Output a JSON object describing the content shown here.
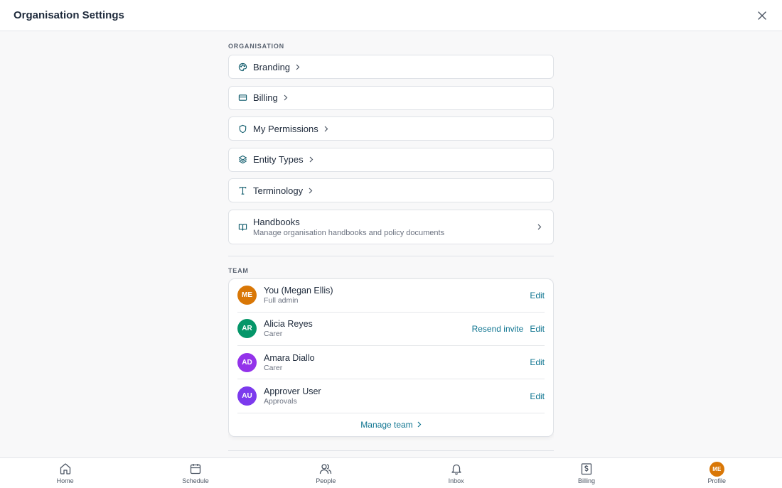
{
  "header": {
    "title": "Organisation Settings"
  },
  "org": {
    "section_label": "ORGANISATION",
    "items": [
      {
        "label": "Branding",
        "icon": "palette-icon"
      },
      {
        "label": "Billing",
        "icon": "credit-card-icon"
      },
      {
        "label": "My Permissions",
        "icon": "shield-icon"
      },
      {
        "label": "Entity Types",
        "icon": "layers-icon"
      },
      {
        "label": "Terminology",
        "icon": "type-icon"
      }
    ],
    "handbooks": {
      "label": "Handbooks",
      "subtitle": "Manage organisation handbooks and policy documents",
      "icon": "book-open-icon"
    }
  },
  "team": {
    "section_label": "TEAM",
    "members": [
      {
        "initials": "ME",
        "name": "You (Megan Ellis)",
        "role": "Full admin",
        "color": "#d97706",
        "actions": [
          "Edit"
        ]
      },
      {
        "initials": "AR",
        "name": "Alicia Reyes",
        "role": "Carer",
        "color": "#059669",
        "actions": [
          "Resend invite",
          "Edit"
        ]
      },
      {
        "initials": "AD",
        "name": "Amara Diallo",
        "role": "Carer",
        "color": "#9333ea",
        "actions": [
          "Edit"
        ]
      },
      {
        "initials": "AU",
        "name": "Approver User",
        "role": "Approvals",
        "color": "#7c3aed",
        "actions": [
          "Edit"
        ]
      }
    ],
    "manage_label": "Manage team"
  },
  "nav": {
    "items": [
      {
        "label": "Home",
        "icon": "home-icon"
      },
      {
        "label": "Schedule",
        "icon": "calendar-icon"
      },
      {
        "label": "People",
        "icon": "users-icon"
      },
      {
        "label": "Inbox",
        "icon": "bell-icon"
      },
      {
        "label": "Billing",
        "icon": "receipt-dollar-icon"
      },
      {
        "label": "Profile",
        "icon": "avatar",
        "initials": "ME",
        "color": "#d97706"
      }
    ]
  },
  "colors": {
    "accent": "#0e7490",
    "text": "#1e2a3b",
    "muted": "#6b7280"
  }
}
